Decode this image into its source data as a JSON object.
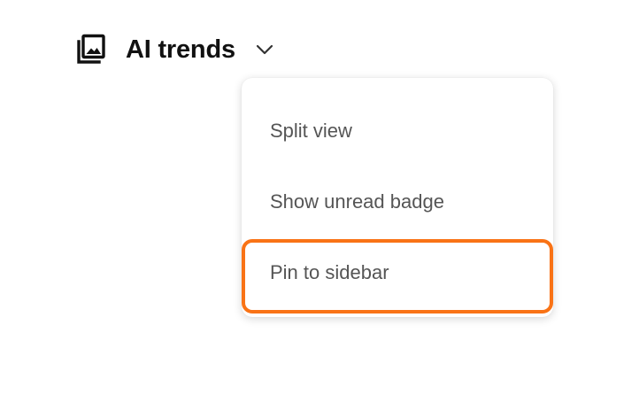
{
  "header": {
    "icon": "photo-library-icon",
    "title": "AI trends",
    "dropdown_icon": "chevron-down-icon"
  },
  "menu": {
    "items": [
      {
        "label": "Split view"
      },
      {
        "label": "Show unread badge"
      },
      {
        "label": "Pin to sidebar",
        "highlighted": true
      }
    ]
  },
  "colors": {
    "highlight": "#f97316",
    "menu_text": "#555555",
    "title_text": "#111111"
  }
}
